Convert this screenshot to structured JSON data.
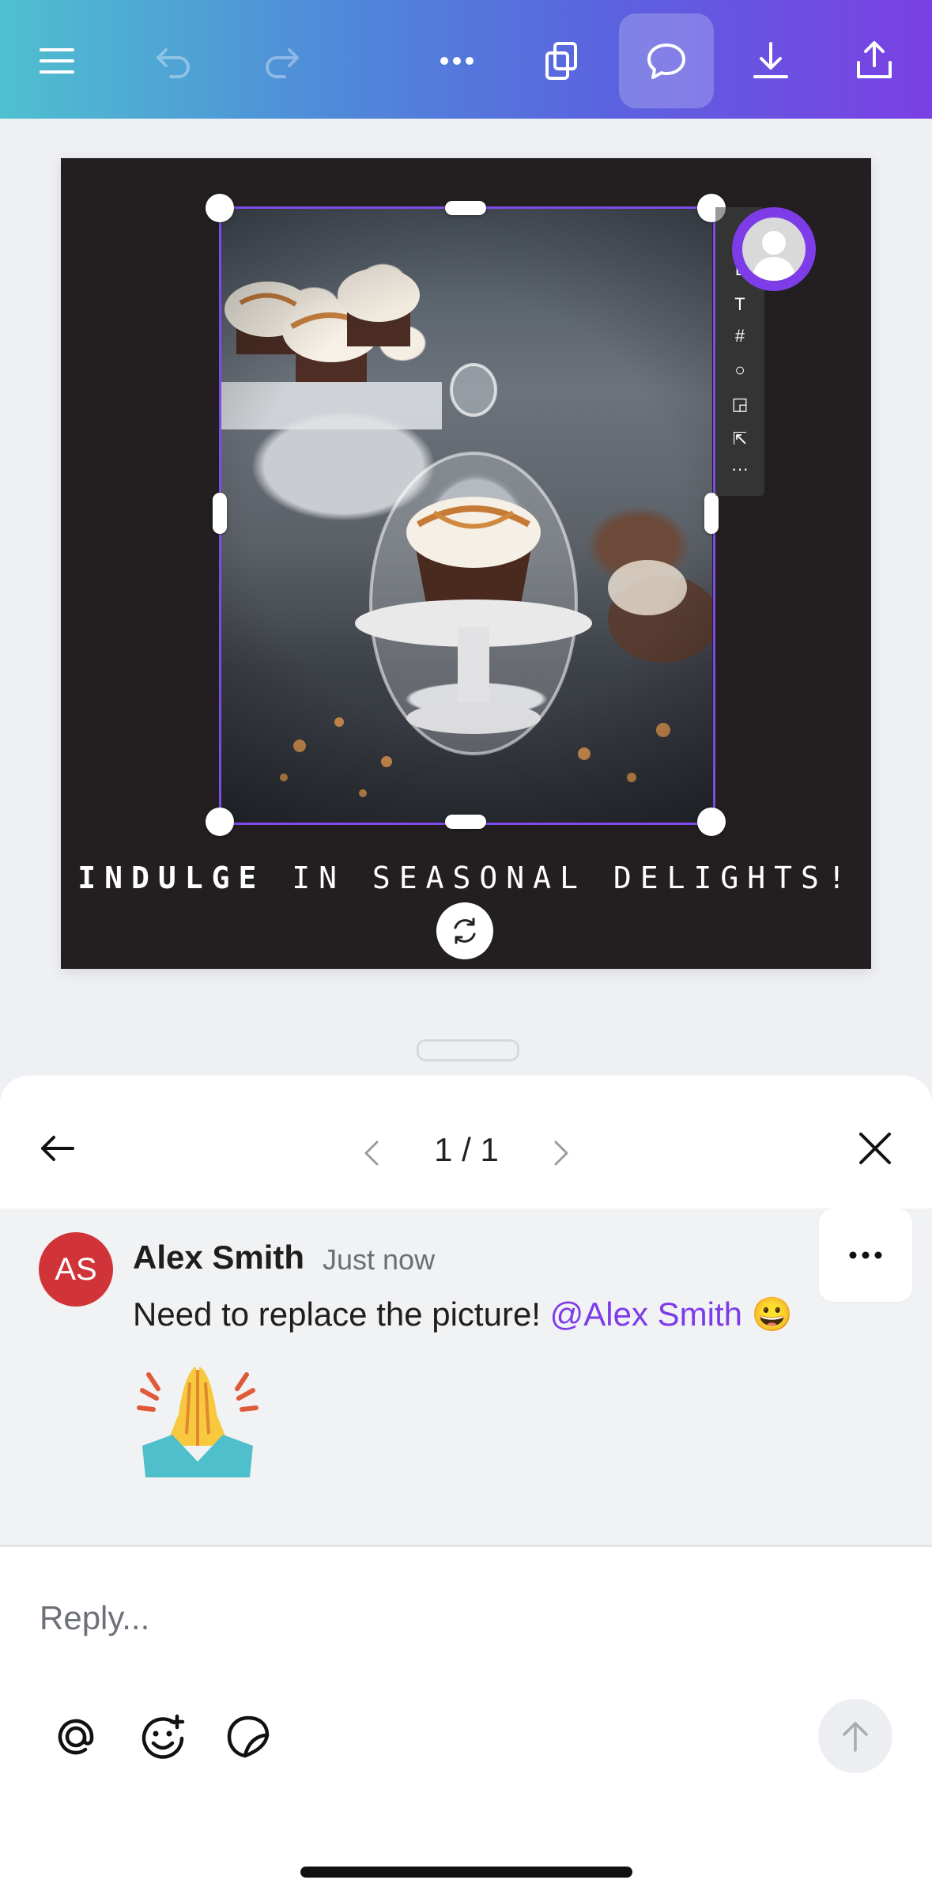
{
  "toolbar": {
    "buttons": [
      {
        "name": "menu",
        "icon": "hamburger-icon"
      },
      {
        "name": "undo",
        "icon": "undo-icon",
        "disabled": true
      },
      {
        "name": "redo",
        "icon": "redo-icon",
        "disabled": true
      },
      {
        "name": "more",
        "icon": "more-horizontal-icon"
      },
      {
        "name": "pages",
        "icon": "pages-icon"
      },
      {
        "name": "comments",
        "icon": "comment-icon",
        "active": true
      },
      {
        "name": "download",
        "icon": "download-icon"
      },
      {
        "name": "share",
        "icon": "share-icon"
      }
    ],
    "gradient": [
      "#4fc0cf",
      "#7b3fe4"
    ]
  },
  "design": {
    "background": "#231f20",
    "headline_bold": "INDULGE",
    "headline_rest": " IN SEASONAL DELIGHTS!",
    "photo_description_icon": "cupcake-photo",
    "selection_color": "#7d4ce8"
  },
  "side_tools": [
    "L",
    "T",
    "#",
    "○",
    "◲",
    "⇱",
    "···"
  ],
  "comment_panel": {
    "pager": "1 / 1",
    "comment": {
      "avatar_initials": "AS",
      "avatar_color": "#d13438",
      "author": "Alex Smith",
      "time": "Just now",
      "text": "Need to replace the picture! ",
      "mention": "@Alex Smith",
      "emoji_inline": "😀",
      "reaction_emoji": "🙏"
    },
    "reply_placeholder": "Reply...",
    "accent_color": "#7d3ce8"
  }
}
